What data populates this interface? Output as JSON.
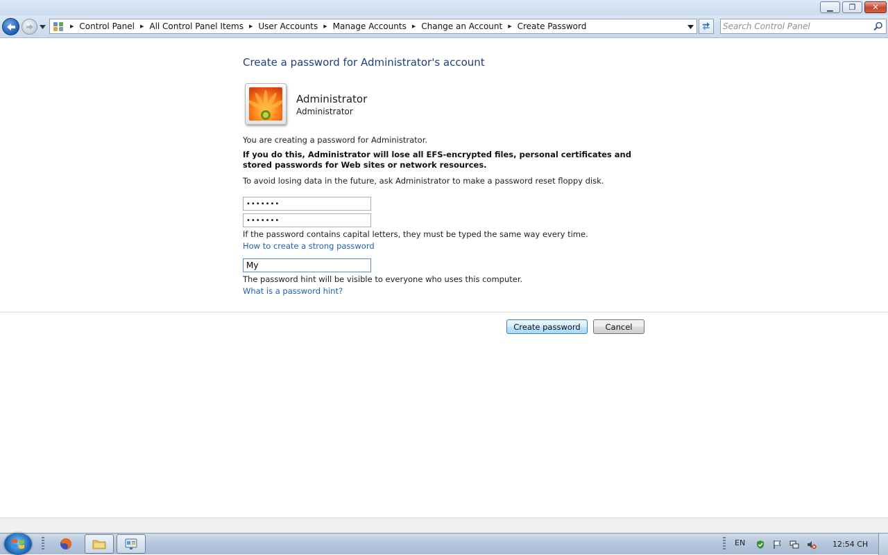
{
  "window": {
    "minimize_glyph": "▁",
    "restore_glyph": "❐",
    "close_glyph": "✕"
  },
  "navigation": {
    "breadcrumbs": [
      "Control Panel",
      "All Control Panel Items",
      "User Accounts",
      "Manage Accounts",
      "Change an Account",
      "Create Password"
    ],
    "search_placeholder": "Search Control Panel",
    "icons": [
      "back-arrow-icon",
      "forward-arrow-icon",
      "control-panel-icon",
      "refresh-icon",
      "search-icon"
    ]
  },
  "page": {
    "title": "Create a password for Administrator's account",
    "account_name": "Administrator",
    "account_type": "Administrator",
    "intro": "You are creating a password for Administrator.",
    "warning": "If you do this, Administrator will lose all EFS-encrypted files, personal certificates and stored passwords for Web sites or network resources.",
    "advice": "To avoid losing data in the future, ask Administrator to make a password reset floppy disk.",
    "new_password_value": "•••••••",
    "confirm_password_value": "•••••••",
    "case_note": "If the password contains capital letters, they must be typed the same way every time.",
    "strong_password_link": "How to create a strong password",
    "hint_value": "My",
    "hint_note": "The password hint will be visible to everyone who uses this computer.",
    "hint_link": "What is a password hint?",
    "create_button": "Create password",
    "cancel_button": "Cancel"
  },
  "taskbar": {
    "language": "EN",
    "clock": "12:54 CH",
    "pinned": [
      "firefox-icon",
      "explorer-folder-icon",
      "control-panel-window-icon"
    ],
    "tray_icons": [
      "action-center-flag-icon",
      "network-icon",
      "volume-muted-icon",
      "security-shield-icon"
    ]
  },
  "colors": {
    "title_blue": "#1e3f7a",
    "link_blue": "#1e5fb4",
    "chrome_blue": "#cad9ec"
  }
}
